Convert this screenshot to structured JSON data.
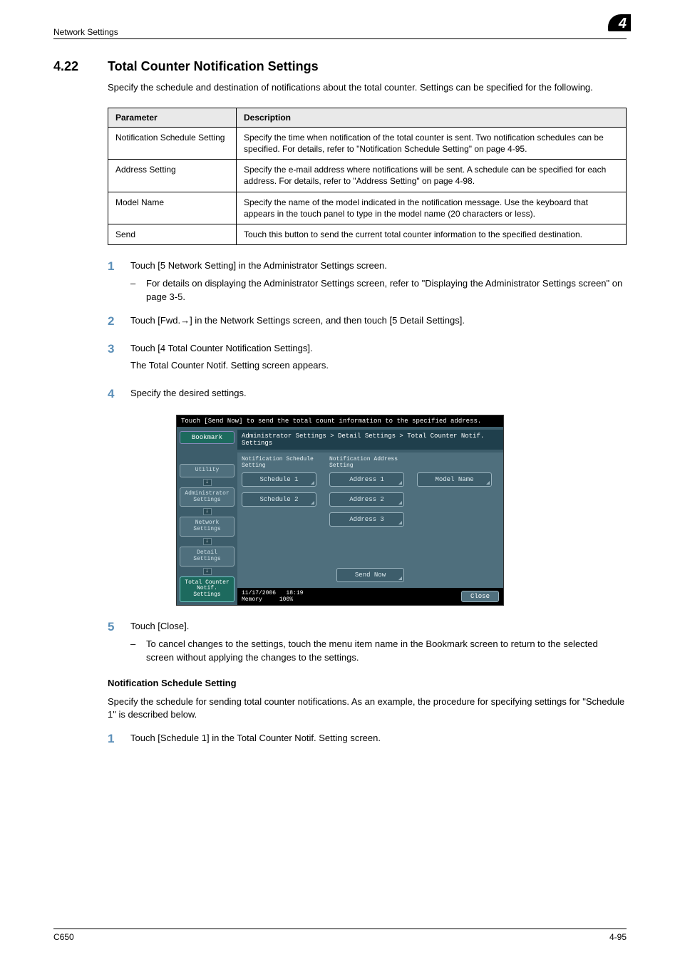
{
  "header": {
    "section": "Network Settings",
    "chapter": "4"
  },
  "section": {
    "number": "4.22",
    "title": "Total Counter Notification Settings",
    "intro": "Specify the schedule and destination of notifications about the total counter. Settings can be specified for the following."
  },
  "table": {
    "headers": [
      "Parameter",
      "Description"
    ],
    "rows": [
      {
        "param": "Notification Schedule Setting",
        "desc": "Specify the time when notification of the total counter is sent. Two notification schedules can be specified. For details, refer to \"Notification Schedule Setting\" on page 4-95."
      },
      {
        "param": "Address Setting",
        "desc": "Specify the e-mail address where notifications will be sent. A schedule can be specified for each address. For details, refer to \"Address Setting\" on page 4-98."
      },
      {
        "param": "Model Name",
        "desc": "Specify the name of the model indicated in the notification message. Use the keyboard that appears in the touch panel to type in the model name (20 characters or less)."
      },
      {
        "param": "Send",
        "desc": "Touch this button to send the current total counter information to the specified destination."
      }
    ]
  },
  "steps": [
    {
      "num": "1",
      "lines": [
        "Touch [5 Network Setting] in the Administrator Settings screen."
      ],
      "sub": [
        "For details on displaying the Administrator Settings screen, refer to \"Displaying the Administrator Settings screen\" on page 3-5."
      ]
    },
    {
      "num": "2",
      "lines": [
        "Touch [Fwd.→] in the Network Settings screen, and then touch [5 Detail Settings]."
      ]
    },
    {
      "num": "3",
      "lines": [
        "Touch [4 Total Counter Notification Settings].",
        "The Total Counter Notif. Setting screen appears."
      ]
    },
    {
      "num": "4",
      "lines": [
        "Specify the desired settings."
      ]
    }
  ],
  "panel": {
    "topline": "Touch [Send Now] to send the total count information to the specified address.",
    "bookmark": "Bookmark",
    "navChain": [
      "Utility",
      "Administrator Settings",
      "Network Settings",
      "Detail Settings",
      "Total Counter Notif. Settings"
    ],
    "breadcrumb": "Administrator Settings > Detail Settings > Total Counter Notif. Settings",
    "col1hd": "Notification Schedule Setting",
    "col2hd": "Notification Address Setting",
    "col1": [
      "Schedule 1",
      "Schedule 2"
    ],
    "col2": [
      "Address 1",
      "Address 2",
      "Address 3"
    ],
    "modelName": "Model Name",
    "sendNow": "Send Now",
    "footer": {
      "date": "11/17/2006",
      "time": "18:19",
      "memLabel": "Memory",
      "mem": "100%",
      "close": "Close"
    }
  },
  "steps_after": [
    {
      "num": "5",
      "lines": [
        "Touch [Close]."
      ],
      "sub": [
        "To cancel changes to the settings, touch the menu item name in the Bookmark screen to return to the selected screen without applying the changes to the settings."
      ]
    }
  ],
  "subsection": {
    "heading": "Notification Schedule Setting",
    "intro": "Specify the schedule for sending total counter notifications. As an example, the procedure for specifying settings for \"Schedule 1\" is described below.",
    "steps": [
      {
        "num": "1",
        "lines": [
          "Touch [Schedule 1] in the Total Counter Notif. Setting screen."
        ]
      }
    ]
  },
  "footer": {
    "left": "C650",
    "right": "4-95"
  }
}
